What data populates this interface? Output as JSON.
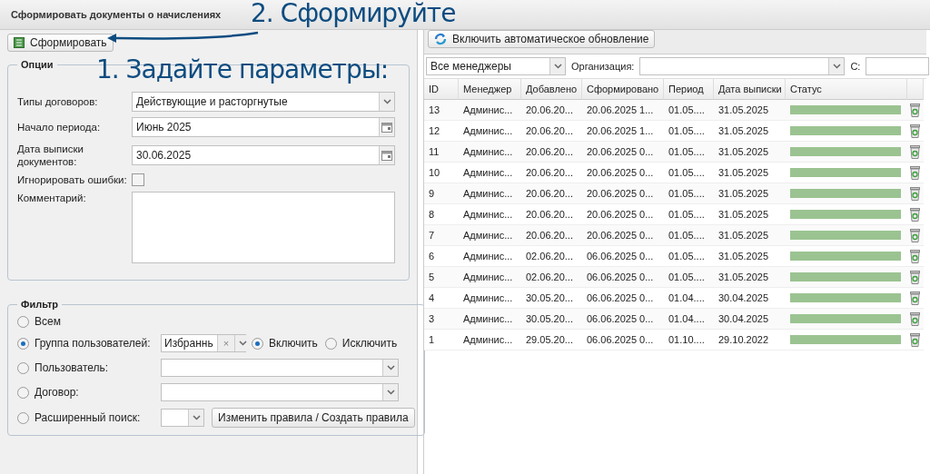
{
  "title": "Сформировать документы о начислениях",
  "annotations": [
    {
      "text": "2. Сформируйте"
    },
    {
      "text": "1. Задайте параметры:"
    }
  ],
  "generate_button": "Сформировать",
  "options": {
    "legend": "Опции",
    "fields": [
      {
        "kind": "select",
        "label": "Типы договоров:",
        "value": "Действующие и расторгнутые"
      },
      {
        "kind": "date",
        "label": "Начало периода:",
        "value": "Июнь 2025"
      },
      {
        "kind": "date",
        "label": "Дата выписки документов:",
        "value": "30.06.2025"
      },
      {
        "kind": "checkbox",
        "label": "Игнорировать ошибки:",
        "checked": false
      },
      {
        "kind": "textarea",
        "label": "Комментарий:"
      }
    ]
  },
  "filter": {
    "legend": "Фильтр",
    "options": [
      {
        "kind": "plain",
        "label": "Всем",
        "selected": false
      },
      {
        "kind": "group",
        "label": "Группа пользователей:",
        "selected": true,
        "value": "Избраннь",
        "clear": "×",
        "modes": [
          {
            "label": "Включить",
            "selected": true
          },
          {
            "label": "Исключить",
            "selected": false
          }
        ]
      },
      {
        "kind": "select",
        "label": "Пользователь:",
        "selected": false
      },
      {
        "kind": "select",
        "label": "Договор:",
        "selected": false
      },
      {
        "kind": "advanced",
        "label": "Расширенный поиск:",
        "selected": false,
        "button": "Изменить правила / Создать правила"
      }
    ]
  },
  "auto_refresh_button": "Включить автоматическое обновление",
  "toolbar_filters": {
    "manager": "Все менеджеры",
    "organization_label": "Организация:",
    "from_label": "С:"
  },
  "table": {
    "columns": [
      "ID",
      "Менеджер",
      "Добавлено",
      "Сформировано",
      "Период",
      "Дата выписки",
      "Статус"
    ],
    "rows": [
      {
        "cells": [
          "13",
          "Админис...",
          "20.06.20...",
          "20.06.2025 1...",
          "01.05....",
          "31.05.2025"
        ],
        "level": 1
      },
      {
        "cells": [
          "12",
          "Админис...",
          "20.06.20...",
          "20.06.2025 1...",
          "01.05....",
          "31.05.2025"
        ],
        "level": 1
      },
      {
        "cells": [
          "11",
          "Админис...",
          "20.06.20...",
          "20.06.2025 0...",
          "01.05....",
          "31.05.2025"
        ],
        "level": 1
      },
      {
        "cells": [
          "10",
          "Админис...",
          "20.06.20...",
          "20.06.2025 0...",
          "01.05....",
          "31.05.2025"
        ],
        "level": 1
      },
      {
        "cells": [
          "9",
          "Админис...",
          "20.06.20...",
          "20.06.2025 0...",
          "01.05....",
          "31.05.2025"
        ],
        "level": 1
      },
      {
        "cells": [
          "8",
          "Админис...",
          "20.06.20...",
          "20.06.2025 0...",
          "01.05....",
          "31.05.2025"
        ],
        "level": 1
      },
      {
        "cells": [
          "7",
          "Админис...",
          "20.06.20...",
          "20.06.2025 0...",
          "01.05....",
          "31.05.2025"
        ],
        "level": 1
      },
      {
        "cells": [
          "6",
          "Админис...",
          "02.06.20...",
          "06.06.2025 0...",
          "01.05....",
          "31.05.2025"
        ],
        "level": 1
      },
      {
        "cells": [
          "5",
          "Админис...",
          "02.06.20...",
          "06.06.2025 0...",
          "01.05....",
          "31.05.2025"
        ],
        "level": 1
      },
      {
        "cells": [
          "4",
          "Админис...",
          "30.05.20...",
          "06.06.2025 0...",
          "01.04....",
          "30.04.2025"
        ],
        "level": 1
      },
      {
        "cells": [
          "3",
          "Админис...",
          "30.05.20...",
          "06.06.2025 0...",
          "01.04....",
          "30.04.2025"
        ],
        "level": 1
      },
      {
        "cells": [
          "1",
          "Админис...",
          "29.05.20...",
          "06.06.2025 0...",
          "01.10....",
          "29.10.2022"
        ],
        "level": 1
      }
    ]
  }
}
